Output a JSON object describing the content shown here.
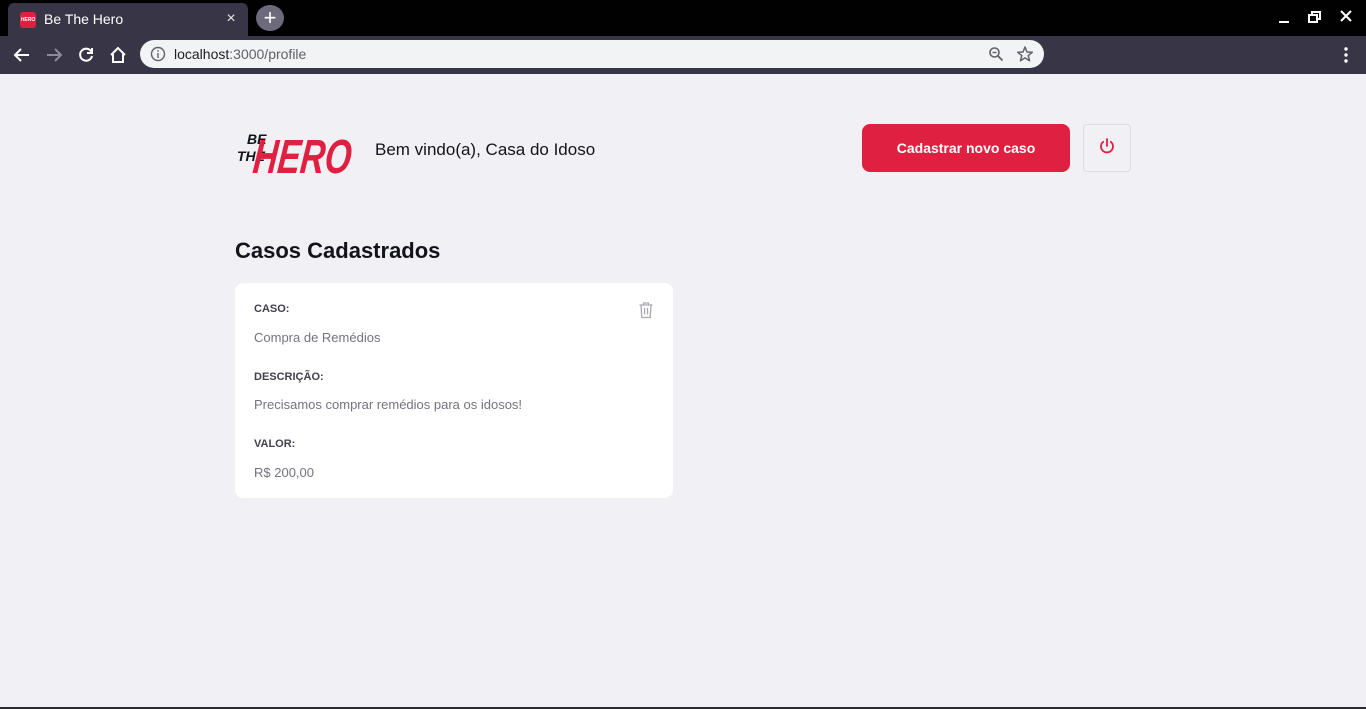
{
  "browser": {
    "tab_title": "Be The Hero",
    "favicon_text": "HERO",
    "url_host": "localhost",
    "url_rest": ":3000/profile",
    "close_tab_symbol": "×",
    "new_tab_symbol": "+"
  },
  "header": {
    "logo_line1": "BE",
    "logo_line2": "THE",
    "logo_word": "HERO",
    "welcome": "Bem vindo(a), Casa do Idoso",
    "new_case_button": "Cadastrar novo caso",
    "logout_icon": "power-icon"
  },
  "main": {
    "title": "Casos Cadastrados",
    "cases": [
      {
        "case_label": "CASO:",
        "case_value": "Compra de Remédios",
        "description_label": "DESCRIÇÃO:",
        "description_value": "Precisamos comprar remédios para os idosos!",
        "value_label": "VALOR:",
        "value_value": "R$ 200,00"
      }
    ]
  },
  "colors": {
    "brand": "#e02041",
    "background": "#f0f0f5",
    "chrome_dark": "#383547",
    "text": "#13131a"
  }
}
